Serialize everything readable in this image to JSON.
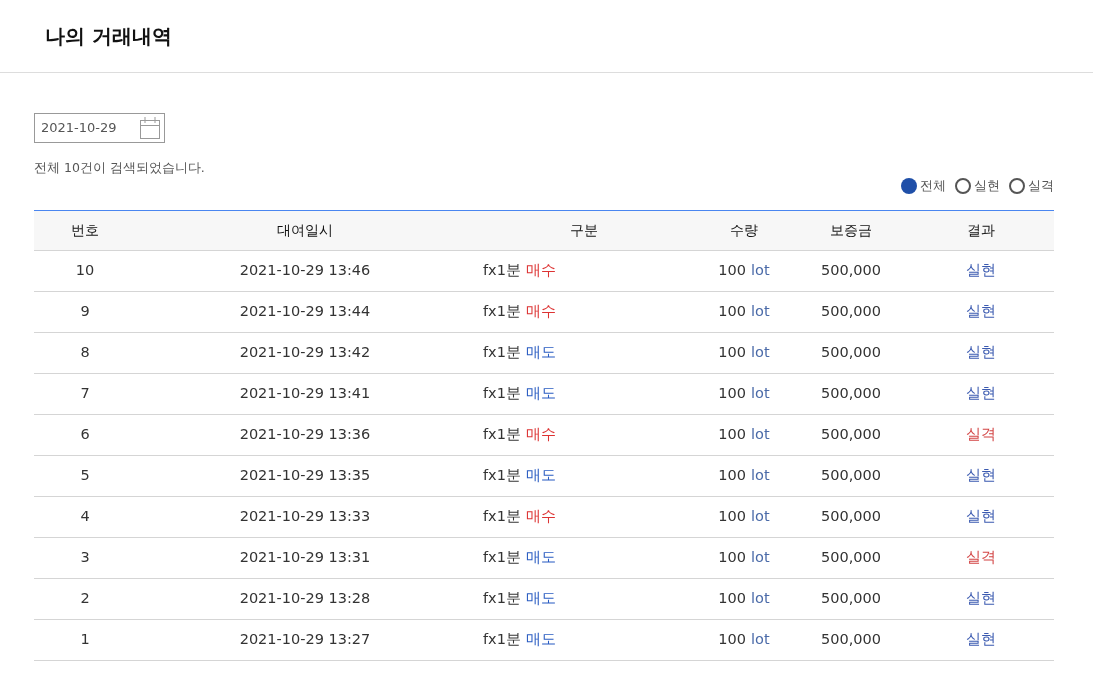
{
  "page_title": "나의 거래내역",
  "date_field": {
    "value": "2021-10-29"
  },
  "result_count": "전체 10건이 검색되었습니다.",
  "filters": [
    {
      "label": "전체",
      "selected": true
    },
    {
      "label": "실현",
      "selected": false
    },
    {
      "label": "실격",
      "selected": false
    }
  ],
  "table": {
    "columns": [
      "번호",
      "대여일시",
      "구분",
      "수량",
      "보증금",
      "결과"
    ],
    "rows": [
      {
        "no": "10",
        "datetime": "2021-10-29 13:46",
        "product": "fx1분",
        "side": {
          "text": "매수",
          "kind": "buy"
        },
        "amount": "100",
        "unit": "lot",
        "deposit": "500,000",
        "result": {
          "text": "실현",
          "kind": "realized"
        }
      },
      {
        "no": "9",
        "datetime": "2021-10-29 13:44",
        "product": "fx1분",
        "side": {
          "text": "매수",
          "kind": "buy"
        },
        "amount": "100",
        "unit": "lot",
        "deposit": "500,000",
        "result": {
          "text": "실현",
          "kind": "realized"
        }
      },
      {
        "no": "8",
        "datetime": "2021-10-29 13:42",
        "product": "fx1분",
        "side": {
          "text": "매도",
          "kind": "sell"
        },
        "amount": "100",
        "unit": "lot",
        "deposit": "500,000",
        "result": {
          "text": "실현",
          "kind": "realized"
        }
      },
      {
        "no": "7",
        "datetime": "2021-10-29 13:41",
        "product": "fx1분",
        "side": {
          "text": "매도",
          "kind": "sell"
        },
        "amount": "100",
        "unit": "lot",
        "deposit": "500,000",
        "result": {
          "text": "실현",
          "kind": "realized"
        }
      },
      {
        "no": "6",
        "datetime": "2021-10-29 13:36",
        "product": "fx1분",
        "side": {
          "text": "매수",
          "kind": "buy"
        },
        "amount": "100",
        "unit": "lot",
        "deposit": "500,000",
        "result": {
          "text": "실격",
          "kind": "failed"
        }
      },
      {
        "no": "5",
        "datetime": "2021-10-29 13:35",
        "product": "fx1분",
        "side": {
          "text": "매도",
          "kind": "sell"
        },
        "amount": "100",
        "unit": "lot",
        "deposit": "500,000",
        "result": {
          "text": "실현",
          "kind": "realized"
        }
      },
      {
        "no": "4",
        "datetime": "2021-10-29 13:33",
        "product": "fx1분",
        "side": {
          "text": "매수",
          "kind": "buy"
        },
        "amount": "100",
        "unit": "lot",
        "deposit": "500,000",
        "result": {
          "text": "실현",
          "kind": "realized"
        }
      },
      {
        "no": "3",
        "datetime": "2021-10-29 13:31",
        "product": "fx1분",
        "side": {
          "text": "매도",
          "kind": "sell"
        },
        "amount": "100",
        "unit": "lot",
        "deposit": "500,000",
        "result": {
          "text": "실격",
          "kind": "failed"
        }
      },
      {
        "no": "2",
        "datetime": "2021-10-29 13:28",
        "product": "fx1분",
        "side": {
          "text": "매도",
          "kind": "sell"
        },
        "amount": "100",
        "unit": "lot",
        "deposit": "500,000",
        "result": {
          "text": "실현",
          "kind": "realized"
        }
      },
      {
        "no": "1",
        "datetime": "2021-10-29 13:27",
        "product": "fx1분",
        "side": {
          "text": "매도",
          "kind": "sell"
        },
        "amount": "100",
        "unit": "lot",
        "deposit": "500,000",
        "result": {
          "text": "실현",
          "kind": "realized"
        }
      }
    ]
  }
}
